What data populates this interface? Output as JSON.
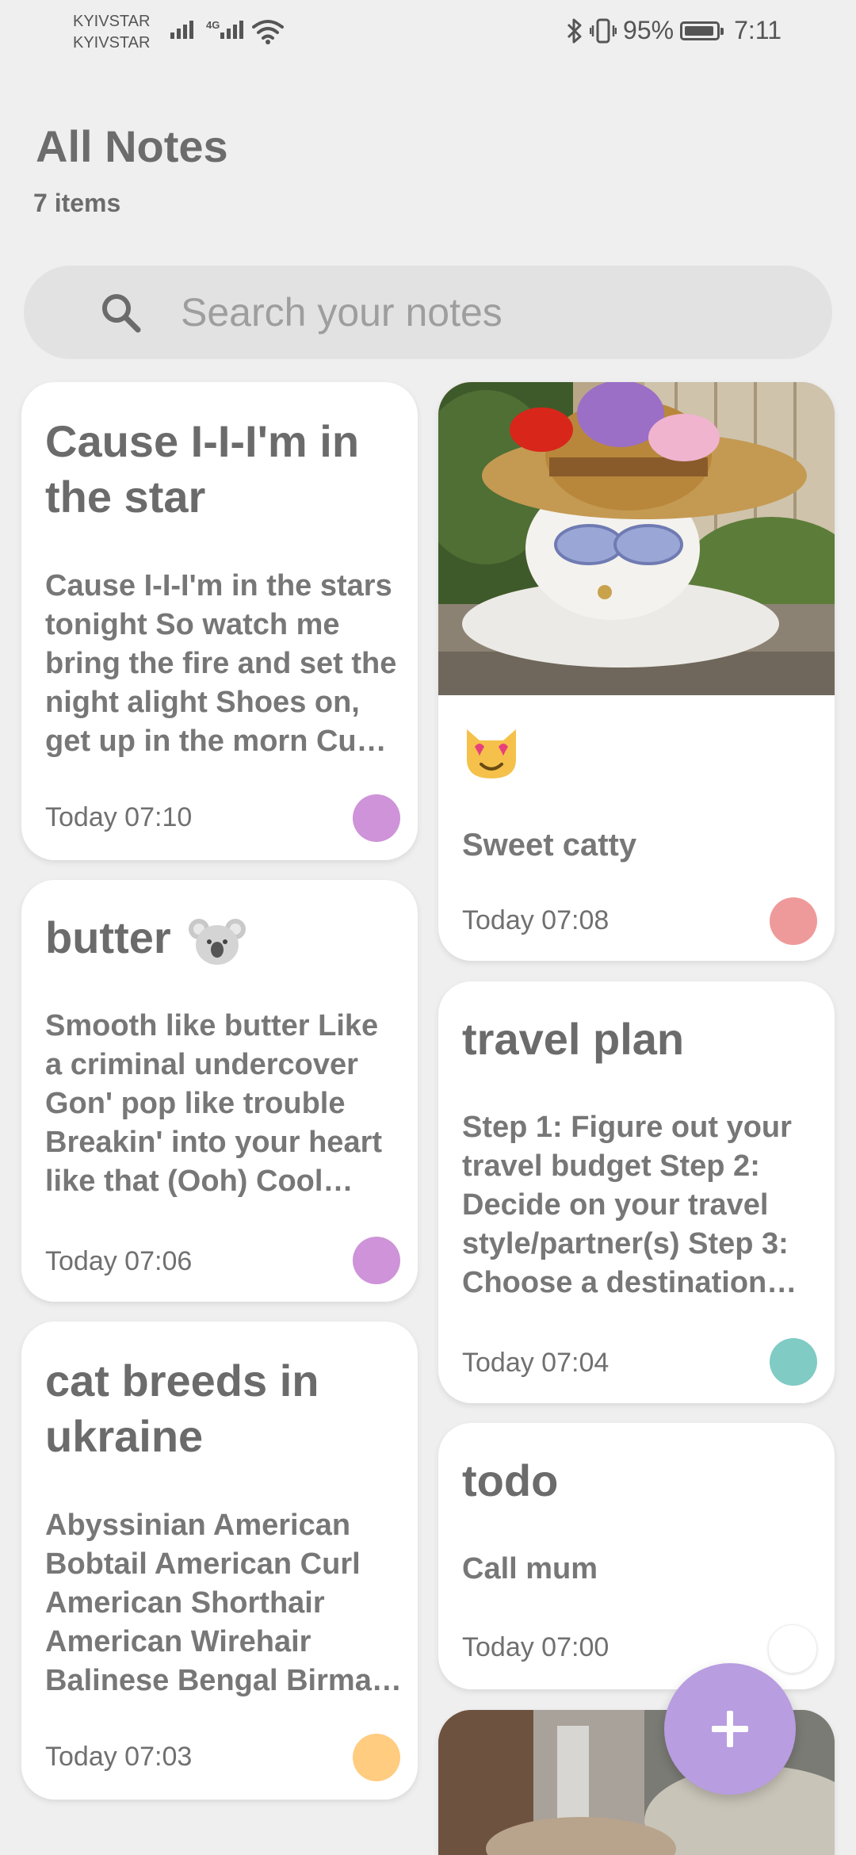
{
  "status_bar": {
    "carrier1": "KYIVSTAR",
    "carrier2": "KYIVSTAR",
    "network": "4G",
    "battery": "95%",
    "battery_level": 0.95,
    "time": "7:11"
  },
  "header": {
    "title": "All Notes",
    "count": "7 items"
  },
  "search": {
    "placeholder": "Search your notes",
    "icon": "search-icon"
  },
  "notes": [
    {
      "title": "Cause I-I-I'm in the star",
      "body": "Cause I-I-I'm in the stars tonight So watch me bring the fire and set the night alight Shoes on, get up in the morn Cup of milk, let's rock and roll",
      "date": "Today 07:10",
      "color": "#ce93d8"
    },
    {
      "title": "",
      "emoji": "smiling-cat-heart-eyes-icon",
      "body": "Sweet catty",
      "date": "Today 07:08",
      "color": "#ef9a9a"
    },
    {
      "title": "butter",
      "emoji": "koala-icon",
      "body": "Smooth like butter Like a criminal undercover Gon' pop like trouble Breakin' into your heart like that (Ooh) Cool shade, stunner",
      "date": "Today 07:06",
      "color": "#ce93d8"
    },
    {
      "title": "travel plan",
      "body": "Step 1: Figure out your travel budget Step 2: Decide on your travel style/partner(s) Step 3: Choose a destination and dates",
      "date": "Today 07:04",
      "color": "#80cbc4"
    },
    {
      "title": "cat breeds in ukraine",
      "body": "Abyssinian American Bobtail American Curl American Shorthair American Wirehair Balinese Bengal Birman Bombay",
      "date": "Today 07:03",
      "color": "#ffcc80"
    },
    {
      "title": "todo",
      "body": "Call mum",
      "date": "Today 07:00",
      "color": "#ffffff"
    }
  ],
  "fab": {
    "icon": "plus-icon"
  }
}
